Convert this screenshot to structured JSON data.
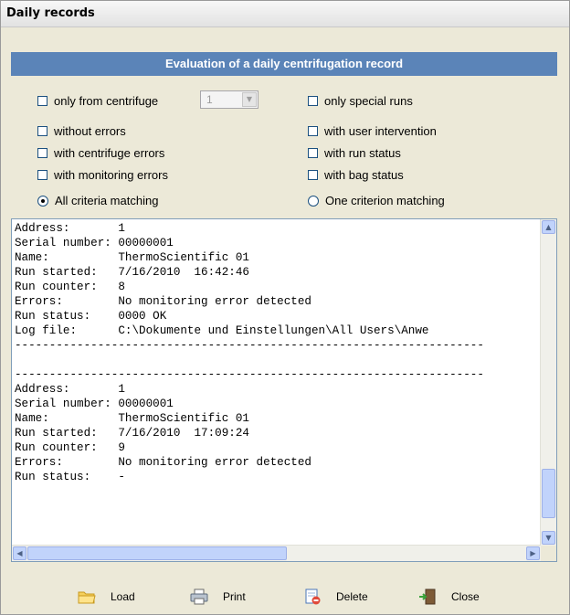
{
  "window": {
    "title": "Daily records"
  },
  "header": {
    "title": "Evaluation of a daily centrifugation record"
  },
  "filters": {
    "only_from_centrifuge": {
      "label": "only from centrifuge",
      "checked": false,
      "value": "1"
    },
    "only_special_runs": {
      "label": "only special runs",
      "checked": false
    },
    "without_errors": {
      "label": "without errors",
      "checked": false
    },
    "with_user_intervention": {
      "label": "with user intervention",
      "checked": false
    },
    "with_centrifuge_errors": {
      "label": "with centrifuge errors",
      "checked": false
    },
    "with_run_status": {
      "label": "with run status",
      "checked": false
    },
    "with_monitoring_errors": {
      "label": "with monitoring errors",
      "checked": false
    },
    "with_bag_status": {
      "label": "with bag status",
      "checked": false
    },
    "match_all": {
      "label": "All criteria matching",
      "selected": true
    },
    "match_one": {
      "label": "One criterion matching",
      "selected": false
    }
  },
  "log": {
    "lines": [
      "Address:       1",
      "Serial number: 00000001",
      "Name:          ThermoScientific 01",
      "Run started:   7/16/2010  16:42:46",
      "Run counter:   8",
      "Errors:        No monitoring error detected",
      "Run status:    0000 OK",
      "Log file:      C:\\Dokumente und Einstellungen\\All Users\\Anwe",
      "--------------------------------------------------------------------",
      "",
      "--------------------------------------------------------------------",
      "Address:       1",
      "Serial number: 00000001",
      "Name:          ThermoScientific 01",
      "Run started:   7/16/2010  17:09:24",
      "Run counter:   9",
      "Errors:        No monitoring error detected",
      "Run status:    -"
    ]
  },
  "buttons": {
    "load": "Load",
    "print": "Print",
    "delete": "Delete",
    "close": "Close"
  },
  "icons": {
    "load": "folder-icon",
    "print": "printer-icon",
    "delete": "delete-document-icon",
    "close": "exit-door-icon"
  }
}
